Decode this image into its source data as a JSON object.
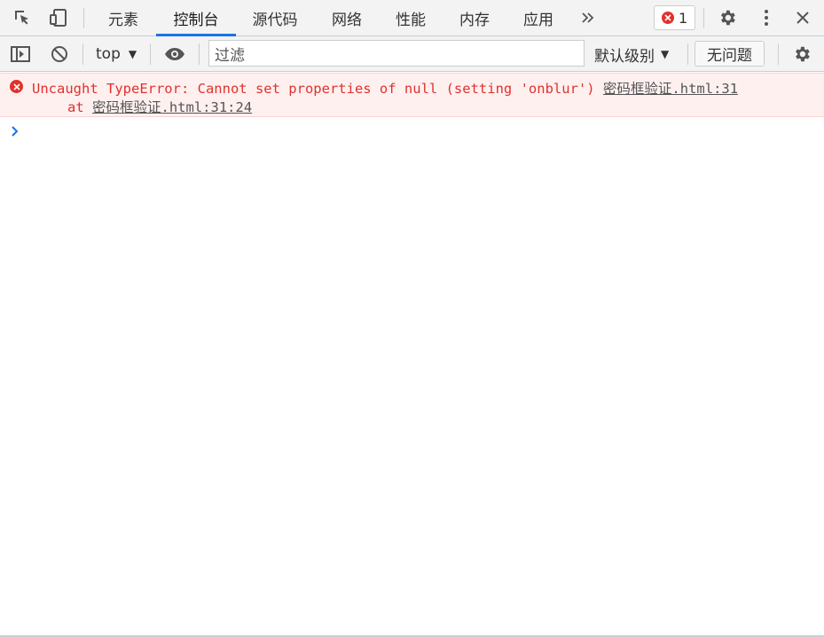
{
  "tabs": {
    "items": [
      {
        "label": "元素",
        "active": false
      },
      {
        "label": "控制台",
        "active": true
      },
      {
        "label": "源代码",
        "active": false
      },
      {
        "label": "网络",
        "active": false
      },
      {
        "label": "性能",
        "active": false
      },
      {
        "label": "内存",
        "active": false
      },
      {
        "label": "应用",
        "active": false
      }
    ],
    "more_icon": "double-chevron-right-icon",
    "error_count": "1"
  },
  "toolbar": {
    "context": "top",
    "filter_placeholder": "过滤",
    "level": "默认级别",
    "issues": "无问题"
  },
  "console": {
    "error": {
      "message": "Uncaught TypeError: Cannot set properties of null (setting 'onblur')",
      "source": "密码框验证.html:31",
      "at_prefix": "at",
      "at_link": "密码框验证.html:31:24"
    }
  },
  "colors": {
    "accent": "#1a73e8",
    "error": "#e0322c",
    "error_bg": "#fff0f0",
    "toolbar_bg": "#f3f3f3"
  }
}
